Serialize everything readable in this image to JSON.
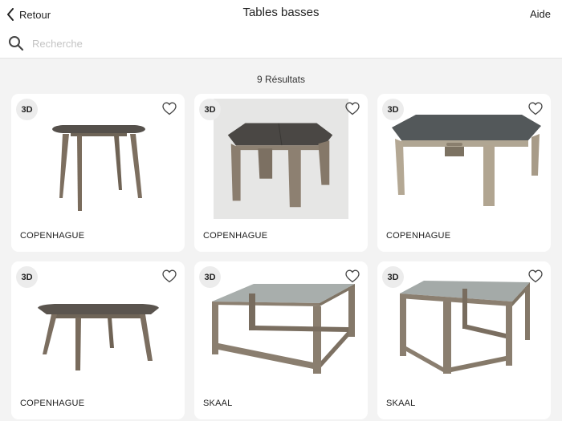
{
  "header": {
    "back_label": "Retour",
    "title": "Tables basses",
    "help_label": "Aide"
  },
  "search": {
    "placeholder": "Recherche",
    "value": ""
  },
  "results_label": "9 Résultats",
  "products": [
    {
      "name": "COPENHAGUE",
      "badge": "3D",
      "image_icon": "table-copenhague-tall-icon"
    },
    {
      "name": "COPENHAGUE",
      "badge": "3D",
      "image_icon": "table-copenhague-photo-icon"
    },
    {
      "name": "COPENHAGUE",
      "badge": "3D",
      "image_icon": "table-copenhague-wide-icon"
    },
    {
      "name": "COPENHAGUE",
      "badge": "3D",
      "image_icon": "table-copenhague-low-icon"
    },
    {
      "name": "SKAAL",
      "badge": "3D",
      "image_icon": "table-skaal-rectangular-icon"
    },
    {
      "name": "SKAAL",
      "badge": "3D",
      "image_icon": "table-skaal-square-icon"
    }
  ],
  "colors": {
    "background": "#f3f3f3",
    "card": "#ffffff",
    "wood": "#8a7b6a",
    "top_dark": "#4a4845",
    "top_concrete": "#a9adab"
  }
}
